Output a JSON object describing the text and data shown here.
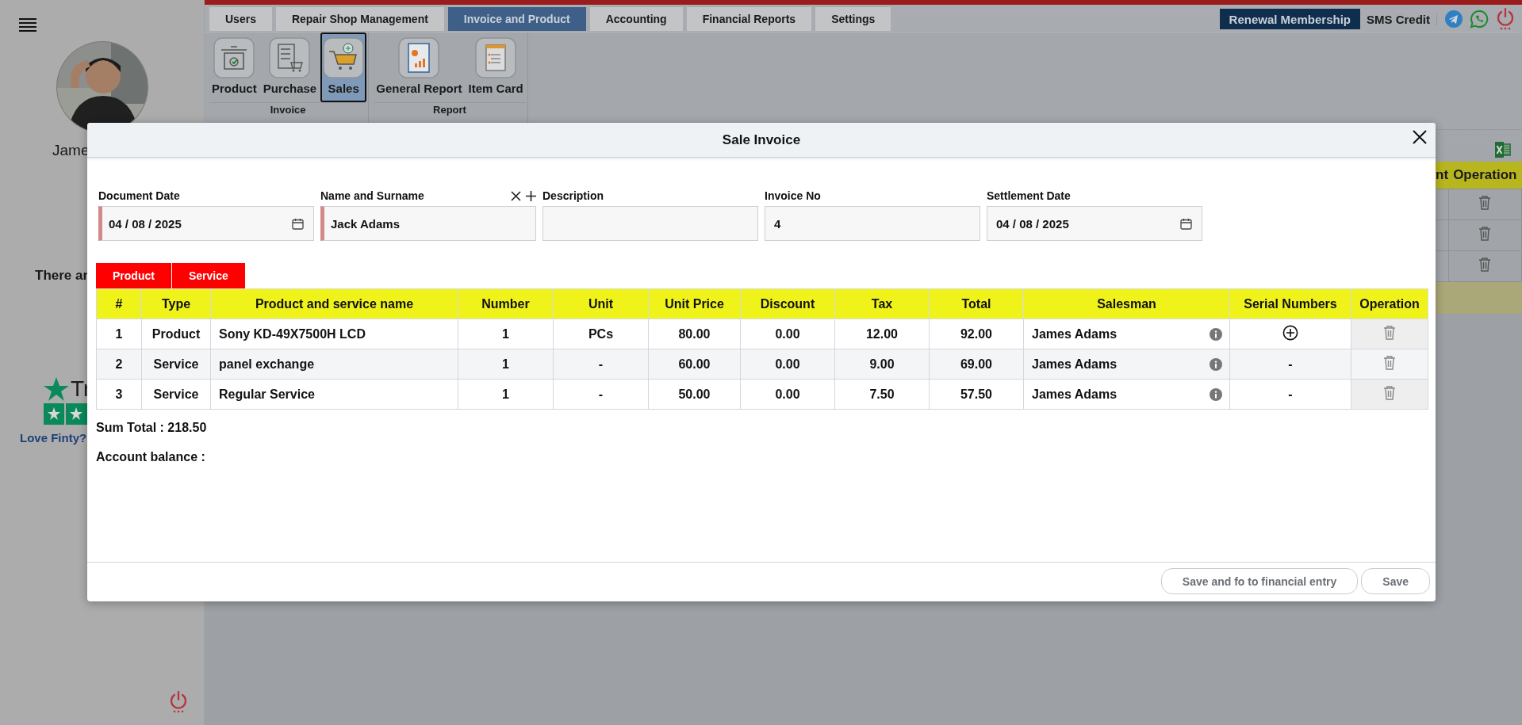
{
  "sidebar": {
    "user_name": "Jame",
    "notice": "There ar",
    "review_brand": "Tr",
    "review_link": "Love Finty?"
  },
  "top_tabs": [
    {
      "label": "Users",
      "selected": false
    },
    {
      "label": "Repair Shop Management",
      "selected": false
    },
    {
      "label": "Invoice and Product",
      "selected": true
    },
    {
      "label": "Accounting",
      "selected": false
    },
    {
      "label": "Financial Reports",
      "selected": false
    },
    {
      "label": "Settings",
      "selected": false
    }
  ],
  "top_actions": {
    "renewal": "Renewal Membership",
    "sms": "SMS Credit"
  },
  "ribbon": {
    "groups": [
      {
        "label": "Invoice",
        "items": [
          {
            "label": "Product",
            "kind": "product",
            "selected": false
          },
          {
            "label": "Purchase",
            "kind": "purchase",
            "selected": false
          },
          {
            "label": "Sales",
            "kind": "sales",
            "selected": true
          }
        ]
      },
      {
        "label": "Report",
        "items": [
          {
            "label": "General Report",
            "kind": "report",
            "selected": false
          },
          {
            "label": "Item Card",
            "kind": "card",
            "selected": false
          }
        ]
      }
    ]
  },
  "background_table": {
    "columns": [
      "nt",
      "Operation"
    ],
    "rows": [
      {
        "kind": "item"
      },
      {
        "kind": "item"
      },
      {
        "kind": "item"
      },
      {
        "kind": "summary"
      }
    ]
  },
  "modal": {
    "title": "Sale Invoice",
    "fields": [
      {
        "label": "Document Date",
        "value": "04 / 08 / 2025",
        "kind": "date",
        "required": true
      },
      {
        "label": "Name and Surname",
        "value": "Jack Adams",
        "kind": "customer",
        "required": true
      },
      {
        "label": "Description",
        "kind": "text",
        "required": false
      },
      {
        "label": "Invoice No",
        "value": "4",
        "kind": "text",
        "required": false
      },
      {
        "label": "Settlement Date",
        "value": "04 / 08 / 2025",
        "kind": "date",
        "required": false
      }
    ],
    "add_buttons": [
      "Product",
      "Service"
    ],
    "table": {
      "columns": [
        "#",
        "Type",
        "Product and service name",
        "Number",
        "Unit",
        "Unit Price",
        "Discount",
        "Tax",
        "Total",
        "Salesman",
        "Serial Numbers",
        "Operation"
      ],
      "rows": [
        {
          "number": "1",
          "type": "Product",
          "name": "Sony KD-49X7500H LCD",
          "quantity": "1",
          "unit": "PCs",
          "unit_price": "80.00",
          "discount": "0.00",
          "tax": "12.00",
          "total": "92.00",
          "salesman": "James Adams",
          "serial": {
            "kind": "add"
          }
        },
        {
          "number": "2",
          "type": "Service",
          "name": "panel exchange",
          "quantity": "1",
          "unit": "-",
          "unit_price": "60.00",
          "discount": "0.00",
          "tax": "9.00",
          "total": "69.00",
          "salesman": "James Adams",
          "serial": {
            "kind": "text",
            "text": "-"
          }
        },
        {
          "number": "3",
          "type": "Service",
          "name": "Regular Service",
          "quantity": "1",
          "unit": "-",
          "unit_price": "50.00",
          "discount": "0.00",
          "tax": "7.50",
          "total": "57.50",
          "salesman": "James Adams",
          "serial": {
            "kind": "text",
            "text": "-"
          }
        }
      ]
    },
    "sum_total": "Sum Total : 218.50",
    "account_balance": "Account balance :",
    "buttons": [
      "Save and fo to financial entry",
      "Save"
    ]
  }
}
